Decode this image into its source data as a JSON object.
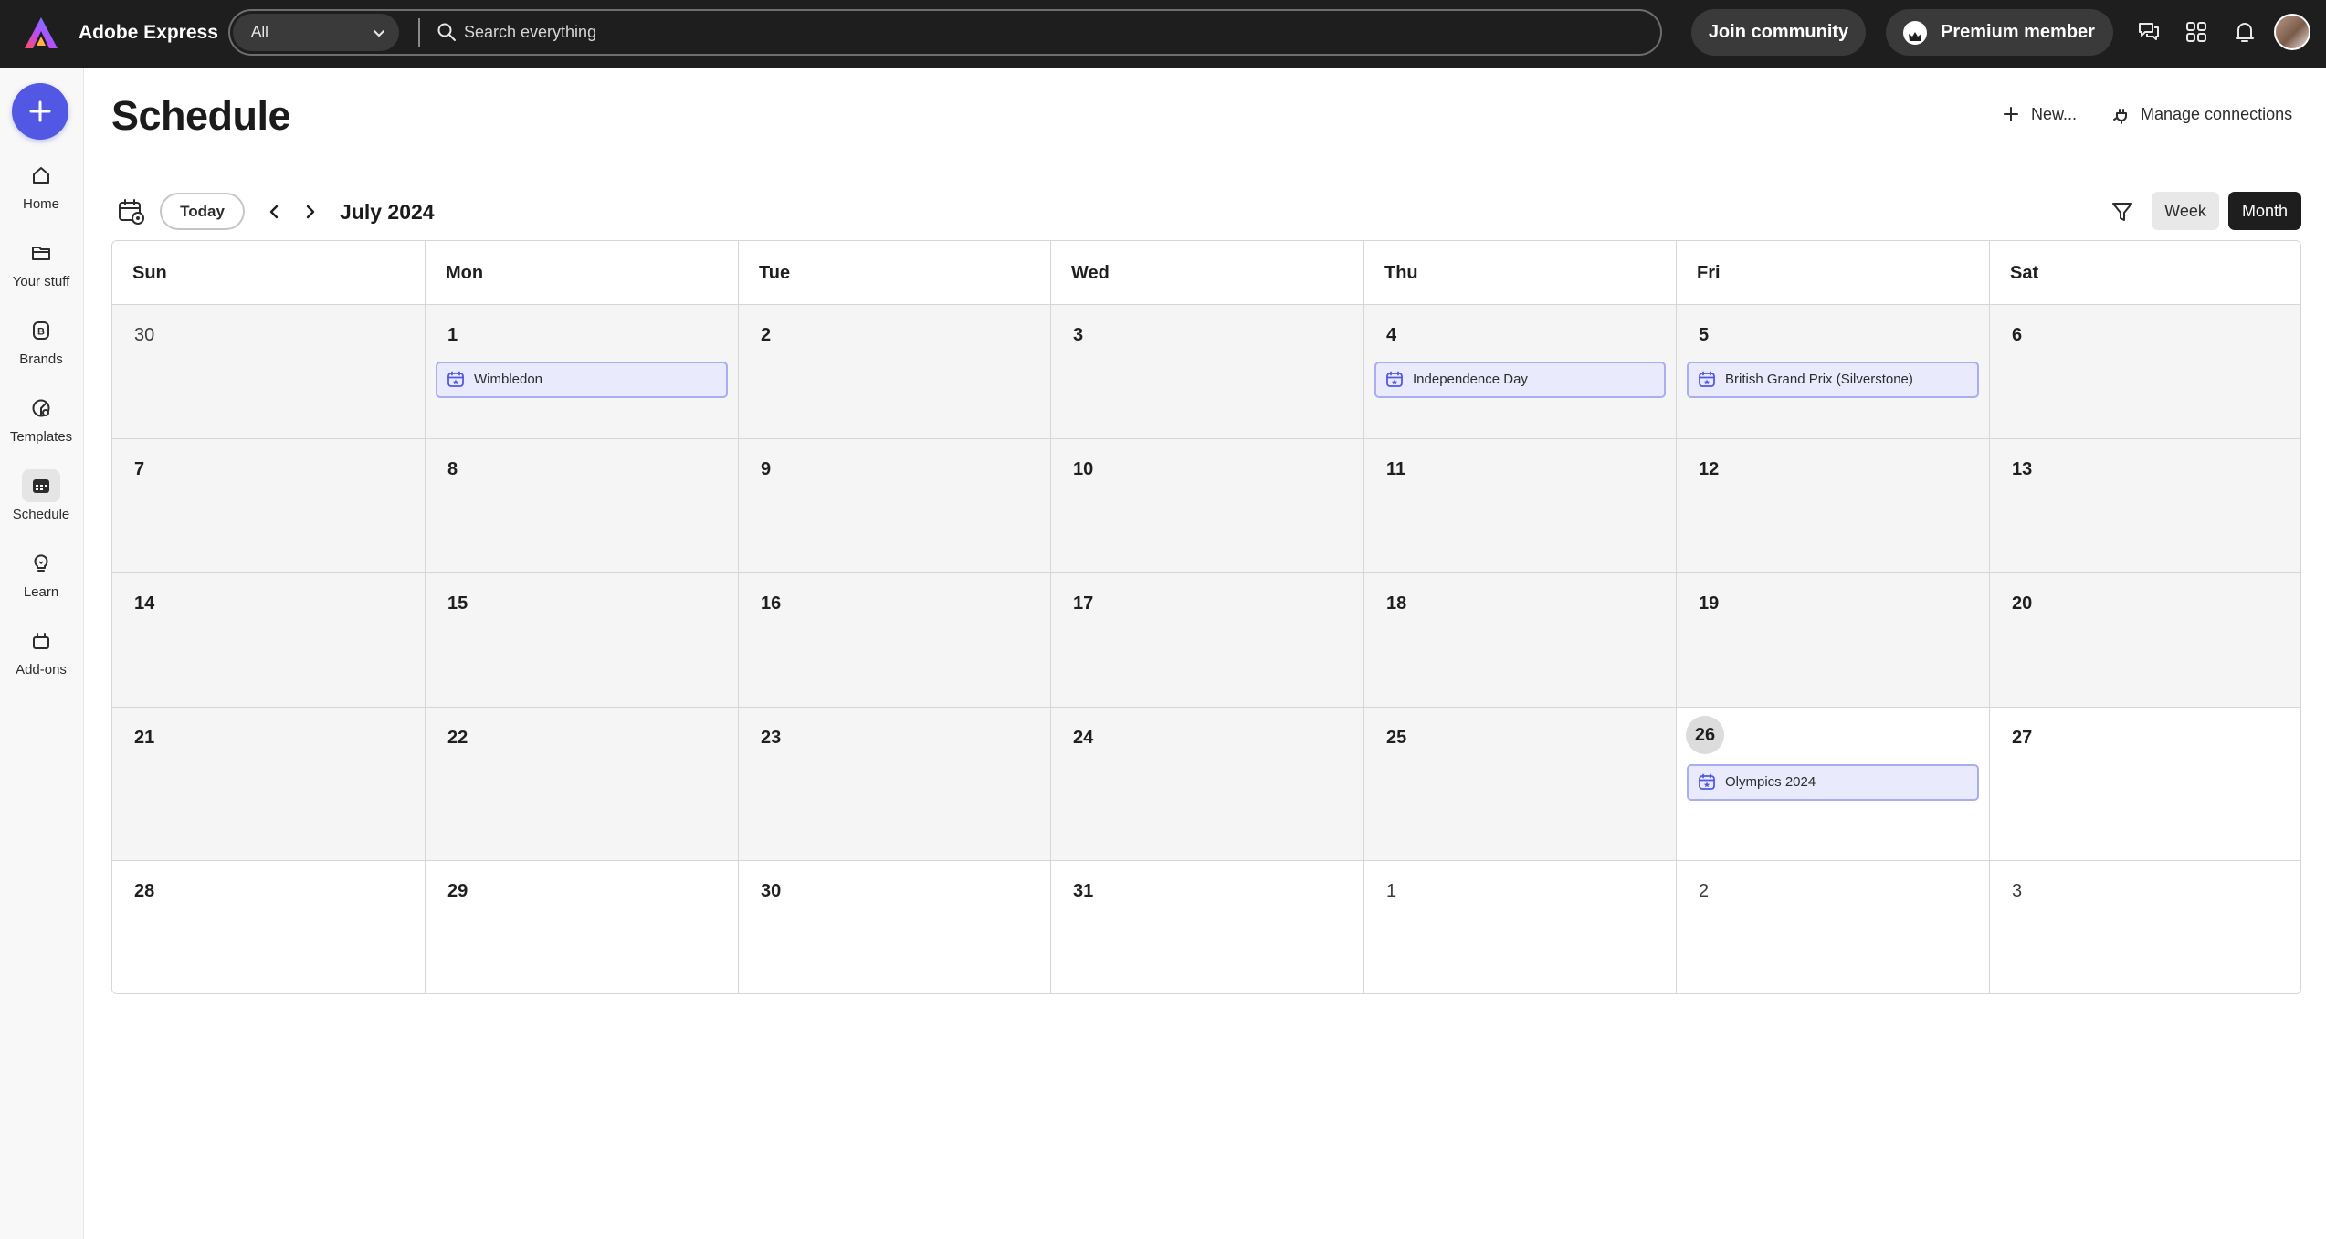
{
  "app": {
    "name": "Adobe Express"
  },
  "search": {
    "scope": "All",
    "placeholder": "Search everything"
  },
  "topbar": {
    "join_label": "Join community",
    "premium_label": "Premium member"
  },
  "rail": {
    "items": [
      {
        "label": "Home",
        "icon": "home-icon"
      },
      {
        "label": "Your stuff",
        "icon": "folder-icon"
      },
      {
        "label": "Brands",
        "icon": "brand-icon"
      },
      {
        "label": "Templates",
        "icon": "templates-icon"
      },
      {
        "label": "Schedule",
        "icon": "calendar-icon",
        "active": true
      },
      {
        "label": "Learn",
        "icon": "lightbulb-icon"
      },
      {
        "label": "Add-ons",
        "icon": "addons-icon"
      }
    ]
  },
  "page": {
    "title": "Schedule",
    "new_label": "New...",
    "manage_label": "Manage connections"
  },
  "toolbar": {
    "today_label": "Today",
    "month_label": "July 2024",
    "week_label": "Week",
    "month_view_label": "Month"
  },
  "calendar": {
    "days_of_week": [
      "Sun",
      "Mon",
      "Tue",
      "Wed",
      "Thu",
      "Fri",
      "Sat"
    ],
    "weeks": [
      [
        "30",
        "1",
        "2",
        "3",
        "4",
        "5",
        "6"
      ],
      [
        "7",
        "8",
        "9",
        "10",
        "11",
        "12",
        "13"
      ],
      [
        "14",
        "15",
        "16",
        "17",
        "18",
        "19",
        "20"
      ],
      [
        "21",
        "22",
        "23",
        "24",
        "25",
        "26",
        "27"
      ],
      [
        "28",
        "29",
        "30",
        "31",
        "1",
        "2",
        "3"
      ]
    ],
    "today": "26",
    "events": {
      "wimbledon": "Wimbledon",
      "independence_day": "Independence Day",
      "british_gp": "British Grand Prix (Silverstone)",
      "olympics": "Olympics 2024"
    }
  },
  "colors": {
    "accent": "#5258e4",
    "event_bg": "#e9eafc",
    "event_border": "#a9adf2",
    "topbar": "#1e1e1e"
  }
}
